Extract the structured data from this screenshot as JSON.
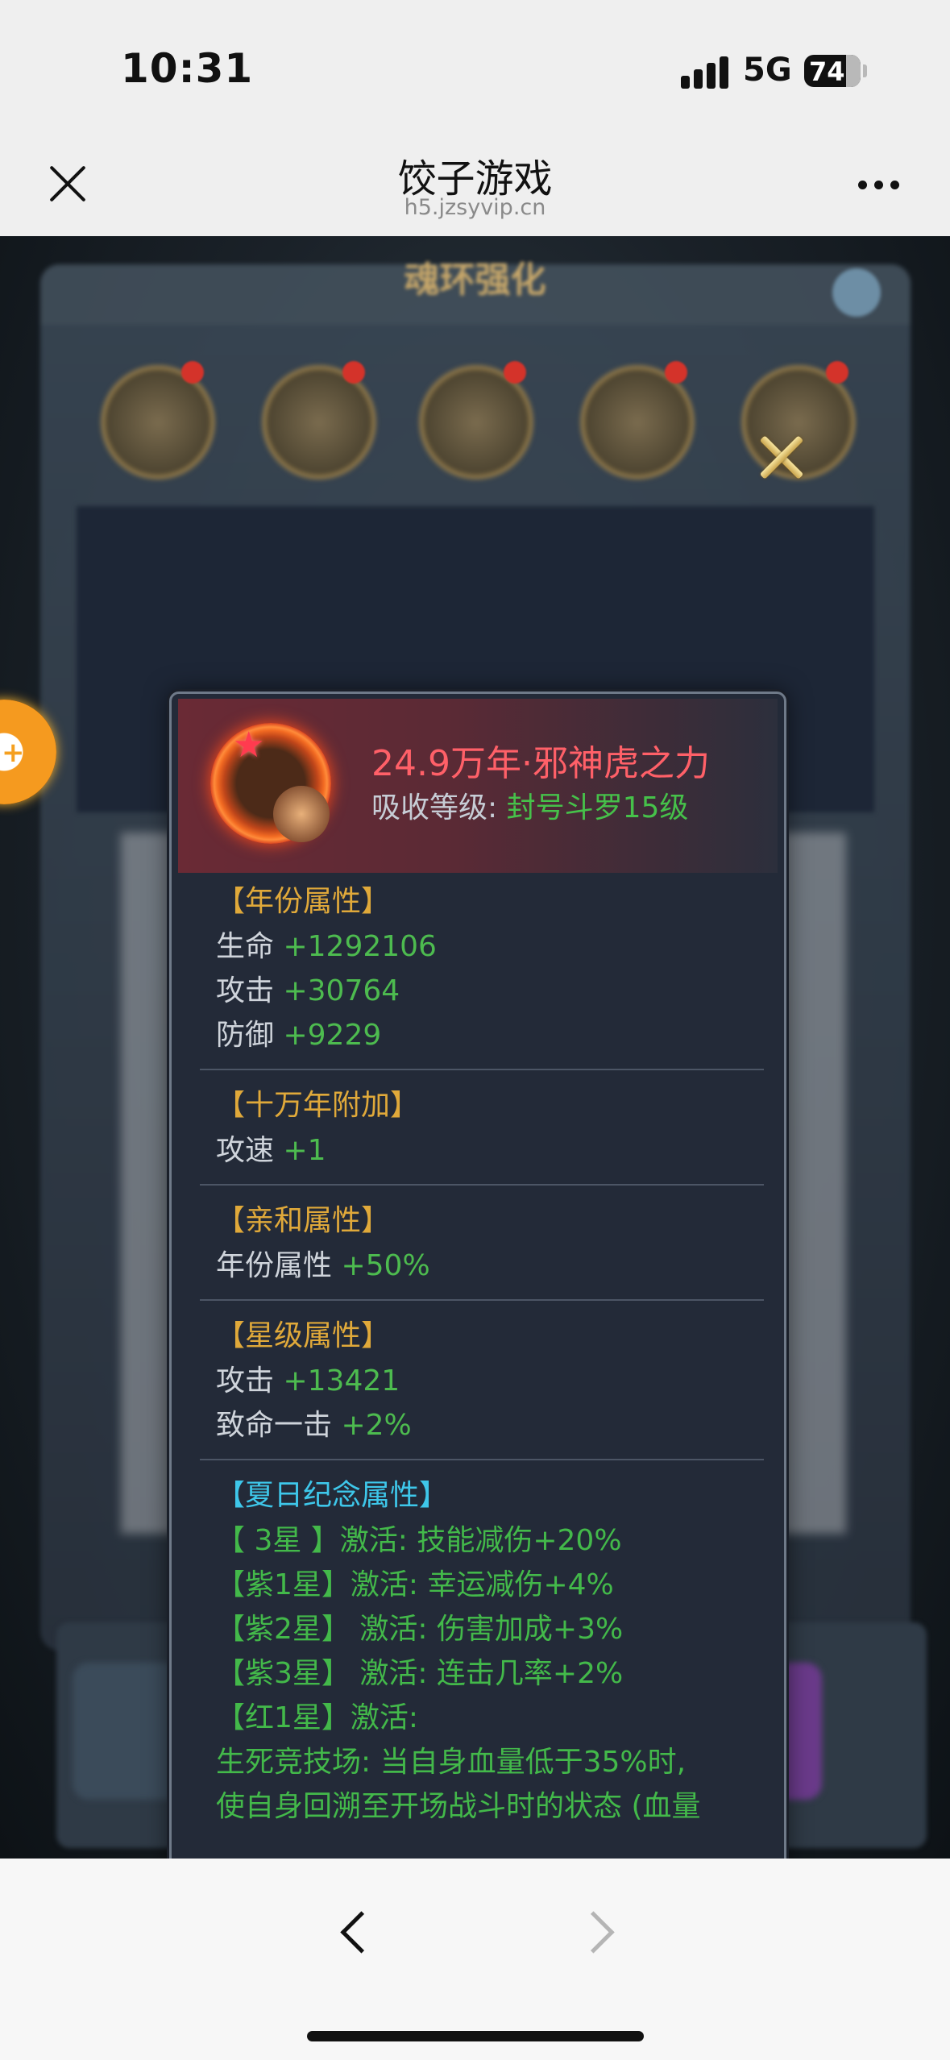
{
  "status_bar": {
    "time": "10:31",
    "network": "5G",
    "battery": "74"
  },
  "nav": {
    "title": "饺子游戏",
    "url": "h5.jzsyvip.cn"
  },
  "background": {
    "panel_title": "魂环强化"
  },
  "popup": {
    "soul_ring_name": "24.9万年·邪神虎之力",
    "absorb_label": "吸收等级:",
    "absorb_value": "封号斗罗15级",
    "sections": {
      "year": {
        "title": "【年份属性】",
        "rows": [
          {
            "k": "生命",
            "v": "+1292106"
          },
          {
            "k": "攻击",
            "v": "+30764"
          },
          {
            "k": "防御",
            "v": "+9229"
          }
        ]
      },
      "hundred_k": {
        "title": "【十万年附加】",
        "rows": [
          {
            "k": "攻速",
            "v": "+1"
          }
        ]
      },
      "affinity": {
        "title": "【亲和属性】",
        "rows": [
          {
            "k": "年份属性",
            "v": "+50%"
          }
        ]
      },
      "star": {
        "title": "【星级属性】",
        "rows": [
          {
            "k": "攻击",
            "v": "+13421"
          },
          {
            "k": "致命一击",
            "v": "+2%"
          }
        ]
      },
      "summer": {
        "title": "【夏日纪念属性】",
        "lines": [
          "【 3星 】激活: 技能减伤+20%",
          "【紫1星】激活: 幸运减伤+4%",
          "【紫2星】 激活: 伤害加成+3%",
          "【紫3星】 激活: 连击几率+2%",
          "【红1星】激活:",
          "生死竞技场: 当自身血量低于35%时,",
          "使自身回溯至开场战斗时的状态 (血量"
        ]
      }
    }
  },
  "colors": {
    "title_red": "#ff6068",
    "value_green": "#4dbb4f",
    "section_gold": "#e0a93a",
    "section_cyan": "#3ec7ea"
  }
}
